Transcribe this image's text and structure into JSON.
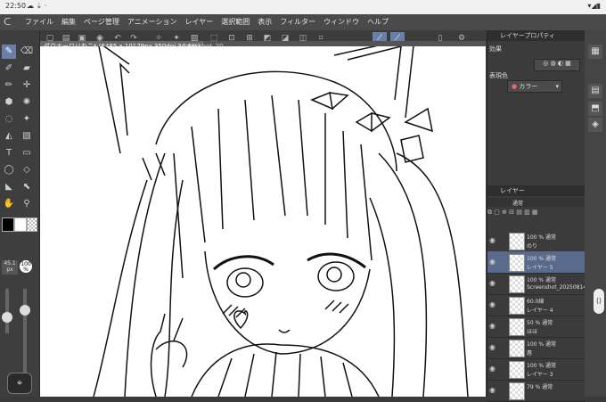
{
  "status": {
    "time": "22:50",
    "icons": "☁ ⇣ ·",
    "right": "▾◢▮"
  },
  "menu": {
    "items": [
      "ファイル",
      "編集",
      "ページ管理",
      "アニメーション",
      "レイヤー",
      "選択範囲",
      "表示",
      "フィルター",
      "ウィンドウ",
      "ヘルプ"
    ]
  },
  "doc": {
    "tab_title": "ダウナーロリねこ* (6485 x 10179px 350dpi 34.6%)",
    "tab2": "Screenshot_20"
  },
  "left": {
    "brush_size": "45.1",
    "brush_unit": "px",
    "opacity": "100",
    "opacity_unit": "%"
  },
  "panel": {
    "layer_property": "レイヤープロパティ",
    "effect": "効果",
    "display_color": "表現色",
    "color_value": "カラー",
    "layer_title": "レイヤー",
    "blend": "通常"
  },
  "layers": [
    {
      "l1": "100 % 通常",
      "l2": "のり",
      "sel": false
    },
    {
      "l1": "100 % 通常",
      "l2": "レイヤー 5",
      "sel": true
    },
    {
      "l1": "100 % 通常",
      "l2": "Screenshot_20250814-",
      "sel": false
    },
    {
      "l1": "60.0線",
      "l2": "レイヤー 4",
      "sel": false
    },
    {
      "l1": "50 % 通常",
      "l2": "ほほ",
      "sel": false
    },
    {
      "l1": "100 % 通常",
      "l2": "唇",
      "sel": false
    },
    {
      "l1": "100 % 通常",
      "l2": "レイヤー 3",
      "sel": false
    },
    {
      "l1": "79 % 通常",
      "l2": "",
      "sel": false
    }
  ],
  "colors": {
    "accent": "#6a7fa8",
    "selected_layer": "#5a6a8c"
  }
}
